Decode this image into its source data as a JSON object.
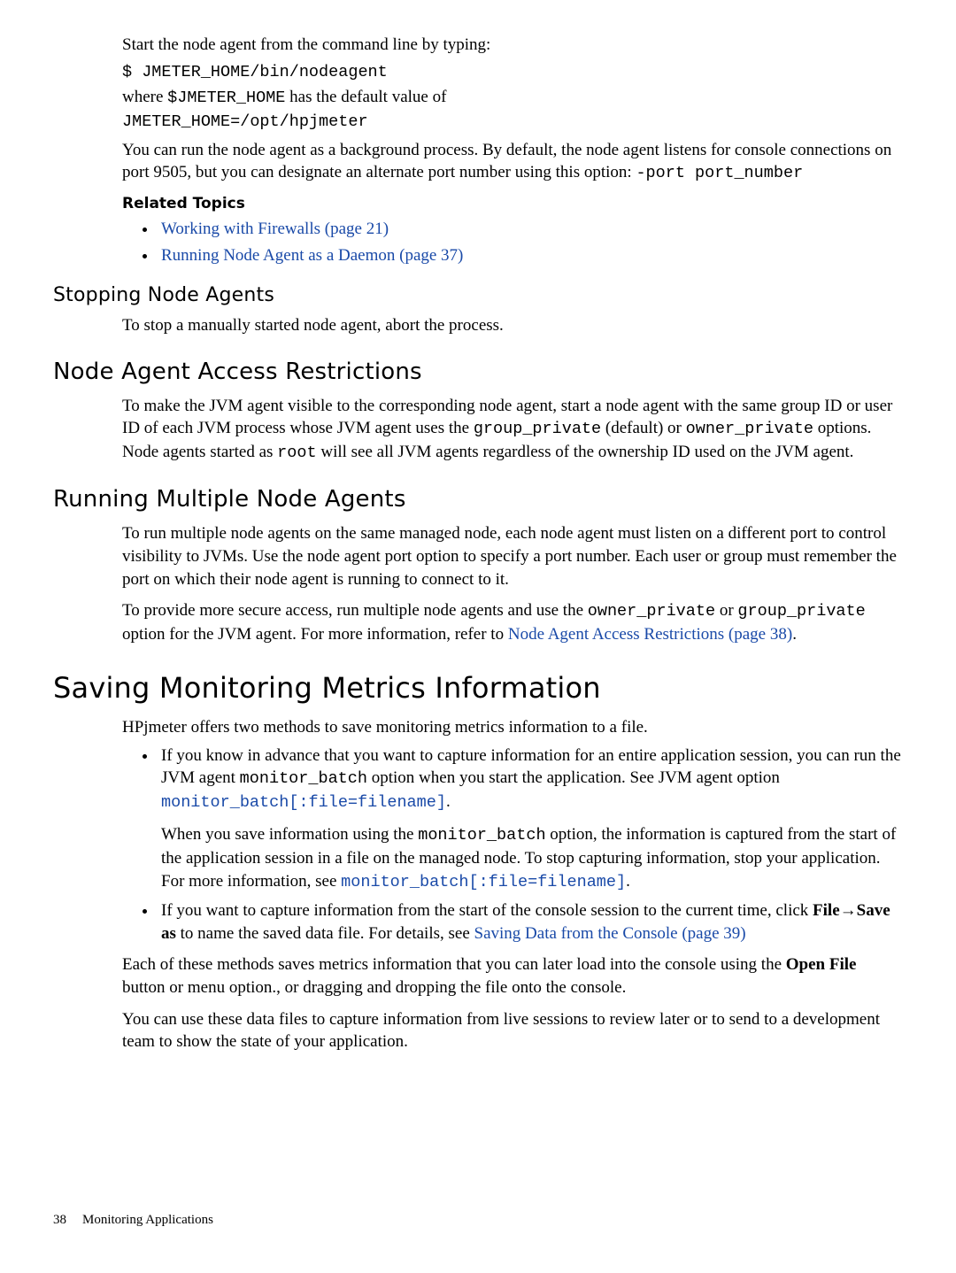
{
  "intro": {
    "p1": "Start the node agent from the command line by typing:",
    "cmd1": "$ JMETER_HOME/bin/nodeagent",
    "p2a": "where ",
    "p2code": "$JMETER_HOME",
    "p2b": " has the default value of",
    "cmd2": "JMETER_HOME=/opt/hpjmeter",
    "p3a": "You can run the node agent as a background process. By default, the node agent listens for console connections on port 9505, but you can designate an alternate port number using this option: ",
    "p3code": "-port port_number"
  },
  "related": {
    "heading": "Related Topics",
    "items": [
      "Working with Firewalls (page 21)",
      "Running Node Agent as a Daemon (page 37)"
    ]
  },
  "stopping": {
    "heading": "Stopping Node Agents",
    "p1": "To stop a manually started node agent, abort the process."
  },
  "access": {
    "heading": "Node Agent Access Restrictions",
    "p1a": "To make the JVM agent visible to the corresponding node agent, start a node agent with the same group ID or user ID of each JVM process whose JVM agent uses the ",
    "code1": "group_private",
    "p1b": " (default) or ",
    "code2": "owner_private",
    "p1c": " options. Node agents started as ",
    "code3": "root",
    "p1d": " will see all JVM agents regardless of the ownership ID used on the JVM agent."
  },
  "multiple": {
    "heading": "Running Multiple Node Agents",
    "p1": "To run multiple node agents on the same managed node, each node agent must listen on a different port to control visibility to JVMs. Use the node agent port option to specify a port number. Each user or group must remember the port on which their node agent is running to connect to it.",
    "p2a": "To provide more secure access, run multiple node agents and use the ",
    "code1": "owner_private",
    "p2b": " or ",
    "code2": "group_private",
    "p2c": " option for the JVM agent. For more information, refer to ",
    "link": "Node Agent Access Restrictions (page 38)",
    "p2d": "."
  },
  "saving": {
    "heading": "Saving Monitoring Metrics Information",
    "p1": "HPjmeter offers two methods to save monitoring metrics information to a file.",
    "b1": {
      "p1a": "If you know in advance that you want to capture information for an entire application session, you can run the JVM agent ",
      "code1": "monitor_batch",
      "p1b": " option when you start the application. See JVM agent option ",
      "linkcode1": "monitor_batch[:file=filename]",
      "p1c": ".",
      "p2a": "When you save information using the ",
      "code2": "monitor_batch",
      "p2b": " option, the information is captured from the start of the application session in a file on the managed node. To stop capturing information, stop your application. For more information, see ",
      "linkcode2": "monitor_batch[:file=filename]",
      "p2c": "."
    },
    "b2": {
      "p1a": "If you want to capture information from the start of the console session to the current time, click ",
      "bold1": "File",
      "arrow": "→",
      "bold2": "Save as",
      "p1b": " to name the saved data file. For details, see ",
      "link": "Saving Data from the Console (page 39)"
    },
    "p2a": "Each of these methods saves metrics information that you can later load into the console using the ",
    "bold3": "Open File",
    "p2b": " button or menu option., or dragging and dropping the file onto the console.",
    "p3": "You can use these data files to capture information from live sessions to review later or to send to a development team to show the state of your application."
  },
  "footer": {
    "page": "38",
    "title": "Monitoring Applications"
  }
}
